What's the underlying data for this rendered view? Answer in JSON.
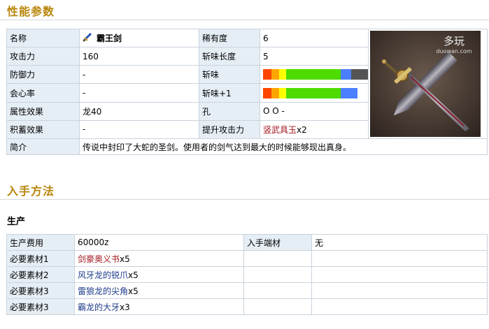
{
  "sections": {
    "specs_title": "性能参数",
    "obtain_title": "入手方法",
    "production_title": "生产"
  },
  "specs": {
    "name_label": "名称",
    "name_value": "霸王剑",
    "rarity_label": "稀有度",
    "rarity_value": "6",
    "attack_label": "攻击力",
    "attack_value": "160",
    "length_label": "斩味长度",
    "length_value": "5",
    "defense_label": "防御力",
    "defense_value": "-",
    "sharpness_label": "斩味",
    "affinity_label": "会心率",
    "affinity_value": "-",
    "sharpness_plus_label": "斩味+1",
    "element_label": "属性效果",
    "element_value": "龙40",
    "slots_label": "孔",
    "slots_value": "O O -",
    "charge_label": "积蓄效果",
    "charge_value": "-",
    "boost_label": "提升攻击力",
    "boost_item": "竖武具玉",
    "boost_qty": "x2",
    "desc_label": "简介",
    "desc_value": "传说中封印了大蛇的圣剑。使用者的剑气达到最大的时候能够现出真身。",
    "watermark_site": "duowan.com",
    "watermark_logo": "多玩"
  },
  "sharpness": {
    "base": [
      {
        "color": "#ff4500",
        "fraction": 0.08
      },
      {
        "color": "#ffa500",
        "fraction": 0.07
      },
      {
        "color": "#ffff00",
        "fraction": 0.07
      },
      {
        "color": "#4ddb00",
        "fraction": 0.52
      },
      {
        "color": "#4c7fff",
        "fraction": 0.1
      },
      {
        "color": "#555555",
        "fraction": 0.16
      }
    ],
    "plus1": [
      {
        "color": "#ff4500",
        "fraction": 0.08
      },
      {
        "color": "#ffa500",
        "fraction": 0.07
      },
      {
        "color": "#ffff00",
        "fraction": 0.07
      },
      {
        "color": "#4ddb00",
        "fraction": 0.52
      },
      {
        "color": "#4c7fff",
        "fraction": 0.16
      },
      {
        "color": "#ffffff",
        "fraction": 0.1
      }
    ]
  },
  "production": {
    "cost_label": "生产费用",
    "cost_value": "60000z",
    "source_label": "入手端材",
    "source_value": "无",
    "materials": [
      {
        "label": "必要素材1",
        "item": "剑豪奥义书",
        "qty": "x5",
        "color": "red"
      },
      {
        "label": "必要素材2",
        "item": "风牙龙的锐爪",
        "qty": "x5",
        "color": "blue"
      },
      {
        "label": "必要素材3",
        "item": "雷狼龙的尖角",
        "qty": "x5",
        "color": "blue"
      },
      {
        "label": "必要素材3",
        "item": "霸龙的大牙",
        "qty": "x3",
        "color": "blue"
      }
    ]
  }
}
